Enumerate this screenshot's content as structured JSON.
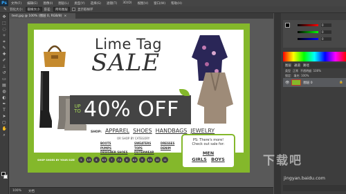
{
  "menubar": {
    "logo": "Ps",
    "items": [
      "文件(F)",
      "编辑(E)",
      "图像(I)",
      "图层(L)",
      "类型(Y)",
      "选择(S)",
      "滤镜(T)",
      "3D(D)",
      "视图(V)",
      "窗口(W)",
      "帮助(H)"
    ]
  },
  "options": {
    "size_label": "羽化大小:",
    "size_value": "取样大小",
    "tolerance_label": "容差:",
    "tolerance_value": "所有图层",
    "antialias_label": "消除锯齿",
    "contiguous_label": "连续",
    "sample_all_label": "显示取样环"
  },
  "document": {
    "tab_title": "test.jpg @ 100% (图层 0, RGB/8)",
    "tab_close": "×",
    "status_zoom": "100%",
    "status_doc": "文档"
  },
  "ad": {
    "headline_1": "Lime Tag",
    "headline_2": "SALE",
    "up_to": "UP TO",
    "discount": "40% OFF",
    "shop_label": "SHOP:",
    "shop_links": [
      "APPAREL",
      "SHOES",
      "HANDBAGS",
      "JEWELRY"
    ],
    "by_category": "OR SHOP BY CATEGORY",
    "categories_col1": [
      "BOOTS",
      "PUMPS",
      "DESIGNER SHOES"
    ],
    "categories_col2": [
      "SWEATERS",
      "TOPS",
      "OUTERWEAR"
    ],
    "categories_col3": [
      "DRESSES",
      "DENIM"
    ],
    "ps_line1": "PS: There's more!",
    "ps_line2": "Check out sale for:",
    "ps_men": "MEN",
    "ps_girls": "GIRLS",
    "ps_boys": "BOYS",
    "sizes_label": "SHOP SHOES BY YOUR SIZE",
    "sizes": [
      "5",
      "5.5",
      "6",
      "6.5",
      "7",
      "7.5",
      "8",
      "8.5",
      "9",
      "9.5",
      "10",
      "11"
    ]
  },
  "color_panel": {
    "values": [
      "0",
      "0",
      "0"
    ]
  },
  "layers": {
    "tabs": [
      "图层",
      "通道",
      "路径"
    ],
    "kind_label": "类型",
    "mode_label": "正常",
    "opacity_label": "不透明度: 100%",
    "lock_label": "锁定:",
    "fill_label": "填充: 100%",
    "layer_name": "图层 0"
  },
  "watermark": {
    "logo": "下载吧",
    "url": "jingyan.baidu.com"
  },
  "colors": {
    "lime": "#84b82b",
    "dark_band": "#444444",
    "ui_dark": "#3d3d3d"
  }
}
